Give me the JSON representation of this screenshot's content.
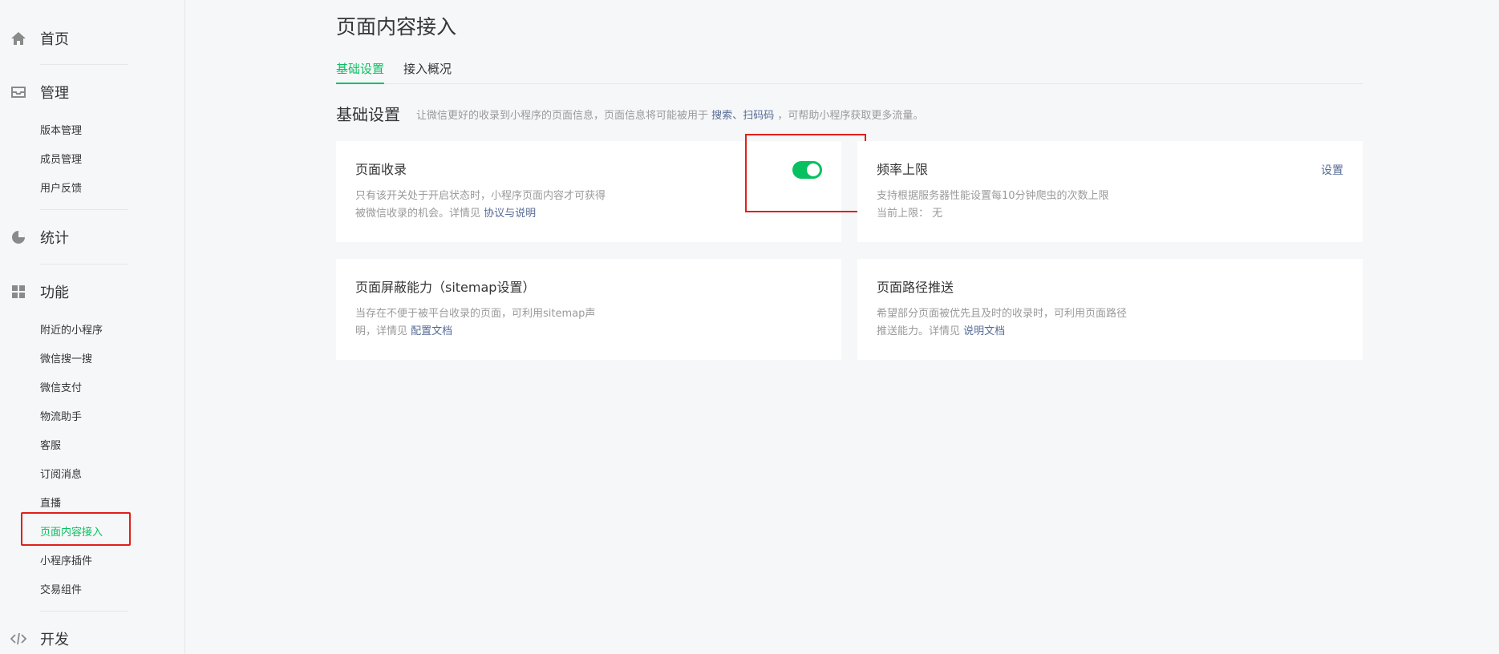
{
  "sidebar": {
    "home": "首页",
    "manage": {
      "label": "管理",
      "items": [
        "版本管理",
        "成员管理",
        "用户反馈"
      ]
    },
    "stats": "统计",
    "features": {
      "label": "功能",
      "items": [
        "附近的小程序",
        "微信搜一搜",
        "微信支付",
        "物流助手",
        "客服",
        "订阅消息",
        "直播",
        "页面内容接入",
        "小程序插件",
        "交易组件"
      ]
    },
    "dev": "开发",
    "active_item": "页面内容接入"
  },
  "main": {
    "title": "页面内容接入",
    "tabs": [
      "基础设置",
      "接入概况"
    ],
    "section": {
      "title": "基础设置",
      "desc_prefix": "让微信更好的收录到小程序的页面信息，页面信息将可能被用于",
      "link1": "搜索",
      "sep": "、",
      "link2": "扫码码",
      "desc_suffix": "，可帮助小程序获取更多流量。"
    },
    "cards": [
      {
        "title": "页面收录",
        "desc_line1": "只有该开关处于开启状态时，小程序页面内容才可获得",
        "desc_line2_prefix": "被微信收录的机会。详情见",
        "link": "协议与说明",
        "switch_on": true
      },
      {
        "title": "频率上限",
        "desc_line1": "支持根据服务器性能设置每10分钟爬虫的次数上限",
        "desc_line2_prefix": "当前上限：",
        "value": "无",
        "action": "设置"
      },
      {
        "title": "页面屏蔽能力（sitemap设置）",
        "desc_line1": "当存在不便于被平台收录的页面，可利用sitemap声",
        "desc_line2_prefix": "明，详情见",
        "link": "配置文档"
      },
      {
        "title": "页面路径推送",
        "desc_line1": "希望部分页面被优先且及时的收录时，可利用页面路径",
        "desc_line2_prefix": "推送能力。详情见",
        "link": "说明文档"
      }
    ]
  },
  "colors": {
    "accent": "#07c160",
    "link": "#576b95",
    "highlight": "#e0201a"
  }
}
